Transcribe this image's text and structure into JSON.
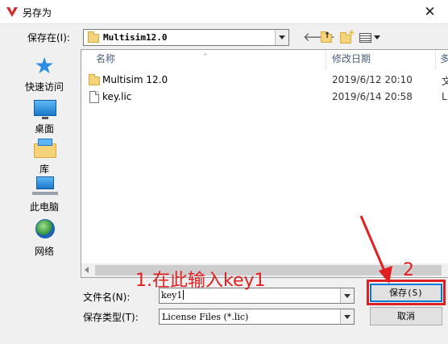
{
  "window": {
    "title": "另存为",
    "close_glyph": "✕"
  },
  "lookin": {
    "label": "保存在(I):",
    "value": "Multisim12.0"
  },
  "toolbar": {
    "icons": [
      "back-icon",
      "up-folder-icon",
      "new-folder-icon",
      "view-menu-icon"
    ]
  },
  "places": [
    {
      "label": "快速访问",
      "icon": "star-icon"
    },
    {
      "label": "桌面",
      "icon": "desktop-icon"
    },
    {
      "label": "库",
      "icon": "library-icon"
    },
    {
      "label": "此电脑",
      "icon": "computer-icon"
    },
    {
      "label": "网络",
      "icon": "network-icon"
    }
  ],
  "filelist": {
    "columns": {
      "name": "名称",
      "date": "修改日期",
      "type": "多"
    },
    "rows": [
      {
        "name": "Multisim 12.0",
        "date": "2019/6/12 20:10",
        "type": "文",
        "icon": "folder-icon"
      },
      {
        "name": "key.lic",
        "date": "2019/6/14 20:58",
        "type": "L",
        "icon": "file-icon"
      }
    ]
  },
  "filename": {
    "label": "文件名(N):",
    "value": "key1"
  },
  "filetype": {
    "label": "保存类型(T):",
    "value": "License Files (*.lic)"
  },
  "buttons": {
    "save": "保存(S)",
    "cancel": "取消"
  },
  "annotations": {
    "step1": "1.在此输入key1",
    "step2": "2"
  },
  "colors": {
    "annotation_red": "#e02020",
    "accent_blue": "#0078d7"
  }
}
